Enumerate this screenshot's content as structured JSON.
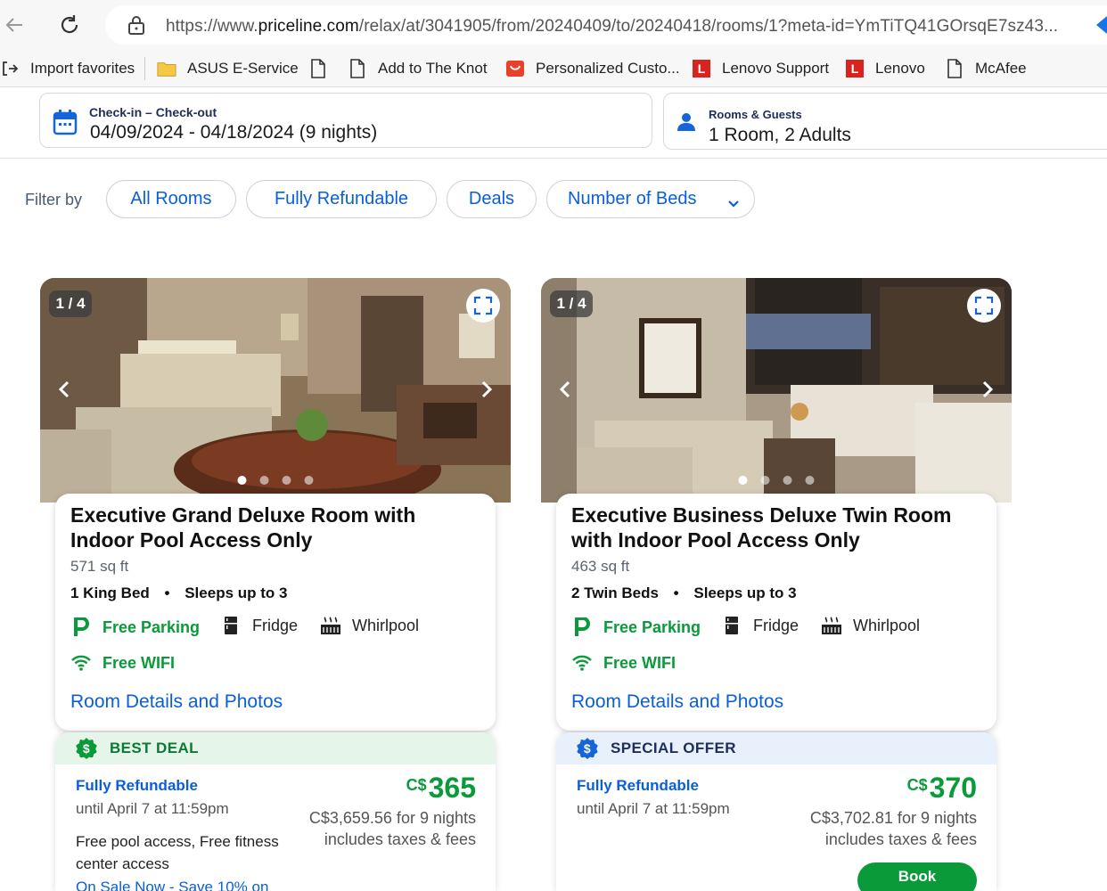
{
  "browser": {
    "url_prefix": "https://www.",
    "url_domain": "priceline.com",
    "url_rest": "/relax/at/3041905/from/20240409/to/20240418/rooms/1?meta-id=YmTiTQ41GOrsqE7sz43...",
    "bookmarks": [
      {
        "label": "Import favorites",
        "icon": "import-icon"
      },
      {
        "label": "ASUS E-Service",
        "icon": "folder-icon"
      },
      {
        "label": "",
        "icon": "page-icon"
      },
      {
        "label": "Add to The Knot",
        "icon": "page-icon"
      },
      {
        "label": "Personalized Custo...",
        "icon": "aliexpress-icon"
      },
      {
        "label": "Lenovo Support",
        "icon": "lenovo-icon"
      },
      {
        "label": "Lenovo",
        "icon": "lenovo-icon"
      },
      {
        "label": "McAfee",
        "icon": "page-icon"
      }
    ]
  },
  "search": {
    "dates_label": "Check-in – Check-out",
    "dates_value": "04/09/2024 - 04/18/2024 (9 nights)",
    "guests_label": "Rooms & Guests",
    "guests_value": "1 Room, 2 Adults"
  },
  "filters": {
    "label": "Filter by",
    "chips": [
      "All Rooms",
      "Fully Refundable",
      "Deals",
      "Number of Beds"
    ]
  },
  "rooms": [
    {
      "counter": "1 / 4",
      "title": "Executive Grand Deluxe Room with Indoor Pool Access Only",
      "sqft": "571 sq ft",
      "bed": "1 King Bed",
      "sleeps": "Sleeps up to 3",
      "amenities": [
        "Free Parking",
        "Fridge",
        "Whirlpool",
        "Free WIFI"
      ],
      "details_link": "Room Details and Photos",
      "deal_label": "BEST DEAL",
      "refund": "Fully Refundable",
      "until": "until April 7 at 11:59pm",
      "perk": "Free pool access, Free fitness center access",
      "sale": "On Sale Now - Save 10% on",
      "currency": "C$",
      "price": "365",
      "total": "C$3,659.56 for 9 nights",
      "taxes": "includes taxes & fees"
    },
    {
      "counter": "1 / 4",
      "title": "Executive Business Deluxe Twin Room with Indoor Pool Access Only",
      "sqft": "463 sq ft",
      "bed": "2 Twin Beds",
      "sleeps": "Sleeps up to 3",
      "amenities": [
        "Free Parking",
        "Fridge",
        "Whirlpool",
        "Free WIFI"
      ],
      "details_link": "Room Details and Photos",
      "deal_label": "SPECIAL OFFER",
      "refund": "Fully Refundable",
      "until": "until April 7 at 11:59pm",
      "currency": "C$",
      "price": "370",
      "total": "C$3,702.81 for 9 nights",
      "taxes": "includes taxes & fees",
      "book": "Book"
    }
  ],
  "colors": {
    "link": "#0a5fd8",
    "green": "#0a9a3a",
    "navy": "#1f2d5c",
    "best_deal_bg": "#e6f5ea",
    "special_offer_bg": "#e7f0fb"
  }
}
